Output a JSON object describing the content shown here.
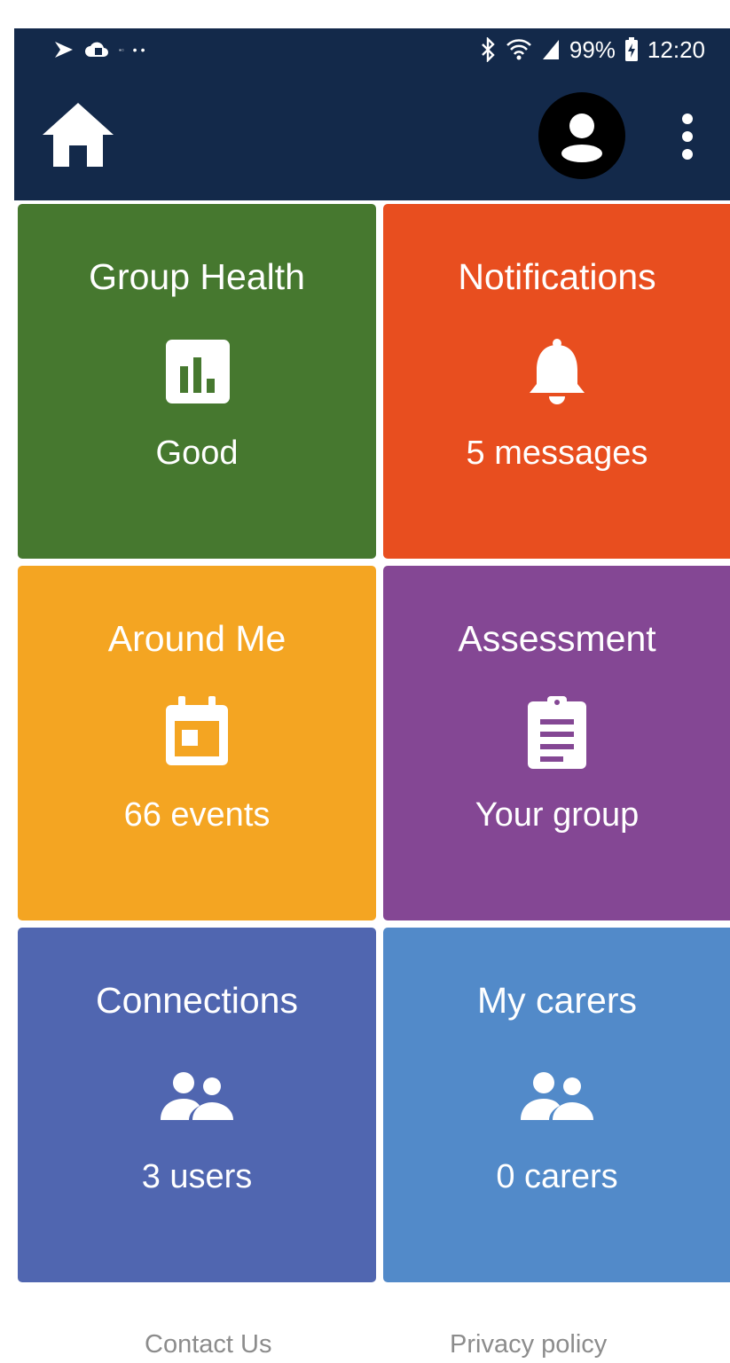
{
  "status_bar": {
    "battery": "99%",
    "time": "12:20"
  },
  "app_bar": {
    "home_icon": "home-icon",
    "avatar_icon": "account-circle-icon",
    "menu_icon": "more-vert-icon"
  },
  "tiles": [
    {
      "title": "Group Health",
      "value": "Good",
      "icon": "bar-chart-icon",
      "color": "#46782f"
    },
    {
      "title": "Notifications",
      "value": "5 messages",
      "icon": "bell-icon",
      "color": "#e84e1f"
    },
    {
      "title": "Around Me",
      "value": "66 events",
      "icon": "calendar-icon",
      "color": "#f4a522"
    },
    {
      "title": "Assessment",
      "value": "Your group",
      "icon": "clipboard-icon",
      "color": "#844794"
    },
    {
      "title": "Connections",
      "value": "3 users",
      "icon": "people-icon",
      "color": "#5066b0"
    },
    {
      "title": "My carers",
      "value": "0 carers",
      "icon": "people-icon",
      "color": "#528ac9"
    }
  ],
  "footer": {
    "contact": "Contact Us",
    "privacy": "Privacy policy"
  }
}
